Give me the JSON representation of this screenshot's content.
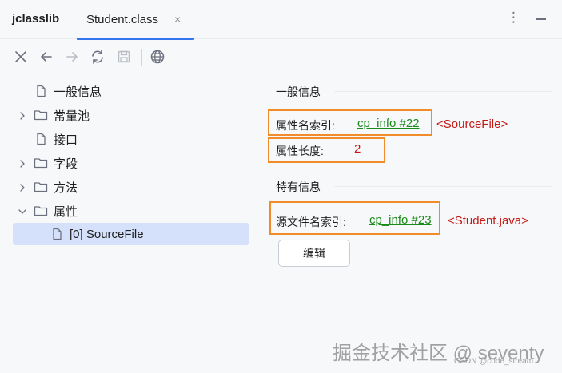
{
  "app": {
    "title": "jclasslib"
  },
  "tab": {
    "label": "Student.class",
    "close_glyph": "×"
  },
  "window_controls": {
    "more_glyph": "⋮"
  },
  "toolbar": {
    "icons": [
      "close-icon",
      "back-arrow-icon",
      "forward-arrow-icon",
      "refresh-icon",
      "save-icon",
      "globe-icon"
    ]
  },
  "tree": {
    "items": [
      {
        "label": "一般信息",
        "icon": "file-icon",
        "expandable": false
      },
      {
        "label": "常量池",
        "icon": "folder-icon",
        "expandable": true,
        "expanded": false
      },
      {
        "label": "接口",
        "icon": "file-icon",
        "expandable": false
      },
      {
        "label": "字段",
        "icon": "folder-icon",
        "expandable": true,
        "expanded": false
      },
      {
        "label": "方法",
        "icon": "folder-icon",
        "expandable": true,
        "expanded": false
      },
      {
        "label": "属性",
        "icon": "folder-icon",
        "expandable": true,
        "expanded": true
      },
      {
        "label": "[0] SourceFile",
        "icon": "file-icon",
        "expandable": false,
        "selected": true
      }
    ]
  },
  "detail": {
    "general": {
      "title": "一般信息",
      "name_index_label": "属性名索引:",
      "name_index_link": "cp_info #22",
      "name_index_comment": "<SourceFile>",
      "length_label": "属性长度:",
      "length_value": "2"
    },
    "specific": {
      "title": "特有信息",
      "source_index_label": "源文件名索引:",
      "source_index_link": "cp_info #23",
      "source_index_comment": "<Student.java>"
    },
    "edit_button": "编辑"
  },
  "watermark": {
    "main": "掘金技术社区 @ seventy",
    "sub": "CSDN @code_stream"
  },
  "colors": {
    "accent": "#3574f0",
    "selection": "#d5e1fb",
    "highlight_box": "#f08c2a",
    "link": "#1b8a1b",
    "value": "#c41a16"
  }
}
